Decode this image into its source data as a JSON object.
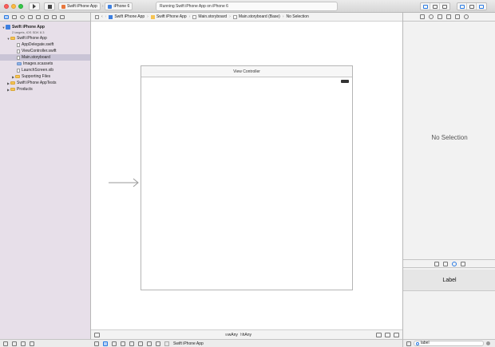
{
  "toolbar": {
    "scheme_name": "Swift iPhone App",
    "device": "iPhone 6",
    "activity_status": "Running Swift iPhone App on iPhone 6"
  },
  "navigator": {
    "project": {
      "name": "Swift iPhone App",
      "subtitle": "2 targets, iOS SDK 8.3"
    },
    "items": [
      {
        "label": "Swift iPhone App",
        "type": "folder",
        "level": 1,
        "expanded": true
      },
      {
        "label": "AppDelegate.swift",
        "type": "file",
        "level": 2
      },
      {
        "label": "ViewController.swift",
        "type": "file",
        "level": 2
      },
      {
        "label": "Main.storyboard",
        "type": "file",
        "level": 2,
        "selected": true
      },
      {
        "label": "Images.xcassets",
        "type": "folder",
        "level": 2
      },
      {
        "label": "LaunchScreen.xib",
        "type": "file",
        "level": 2
      },
      {
        "label": "Supporting Files",
        "type": "folder",
        "level": 2,
        "expanded": false
      },
      {
        "label": "Swift iPhone AppTests",
        "type": "folder",
        "level": 1,
        "expanded": false
      },
      {
        "label": "Products",
        "type": "folder",
        "level": 1,
        "expanded": false
      }
    ]
  },
  "jumpbar": {
    "crumbs": [
      "Swift iPhone App",
      "Swift iPhone App",
      "Main.storyboard",
      "Main.storyboard (Base)",
      "No Selection"
    ]
  },
  "canvas": {
    "scene_title": "View Controller",
    "size_class_w": "wAny",
    "size_class_h": "hAny"
  },
  "debug": {
    "target": "Swift iPhone App"
  },
  "utilities": {
    "no_selection": "No Selection",
    "library_item": "Label",
    "library_filter": "label"
  },
  "colors": {
    "navigator_bg": "#e7dfe9",
    "selection": "#c9c4d6",
    "accent": "#2a7ae2"
  }
}
